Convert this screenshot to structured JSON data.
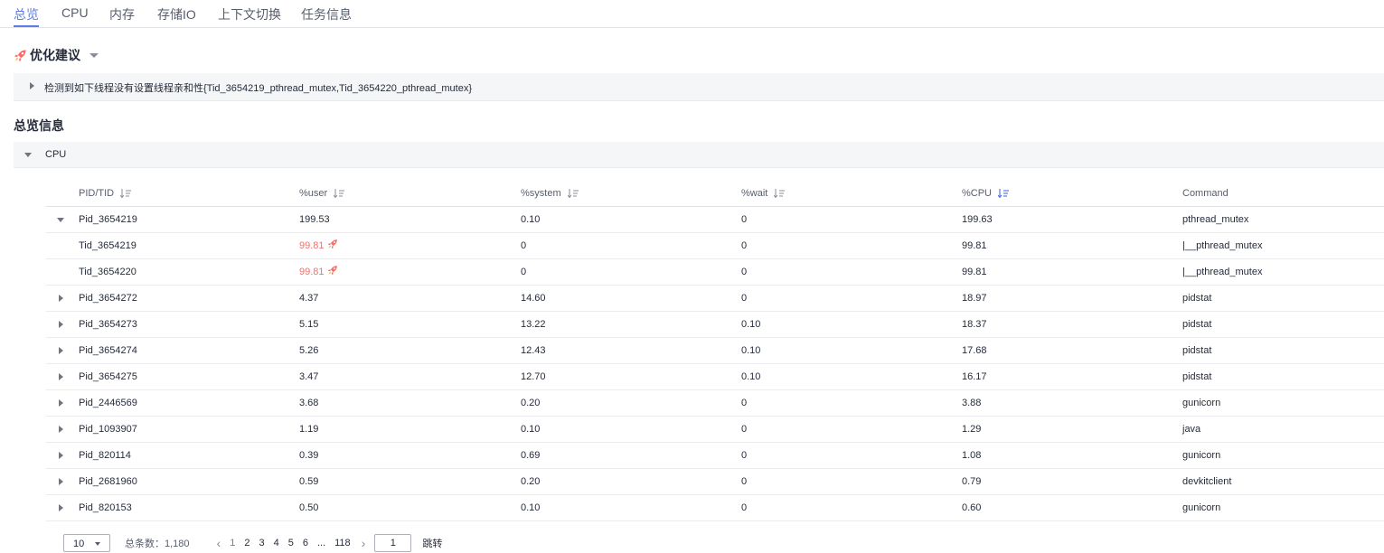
{
  "tabs": [
    {
      "label": "总览",
      "active": true
    },
    {
      "label": "CPU",
      "active": false
    },
    {
      "label": "内存",
      "active": false
    },
    {
      "label": "存储IO",
      "active": false
    },
    {
      "label": "上下文切换",
      "active": false
    },
    {
      "label": "任务信息",
      "active": false
    }
  ],
  "optimization": {
    "title": "优化建议",
    "suggestion": "检测到如下线程没有设置线程亲和性{Tid_3654219_pthread_mutex,Tid_3654220_pthread_mutex}"
  },
  "overview": {
    "title": "总览信息",
    "section_label": "CPU"
  },
  "table": {
    "columns": [
      "PID/TID",
      "%user",
      "%system",
      "%wait",
      "%CPU",
      "Command"
    ],
    "active_sort_column": "%CPU",
    "rows": [
      {
        "pid": "Pid_3654219",
        "user": "199.53",
        "system": "0.10",
        "wait": "0",
        "cpu": "199.63",
        "command": "pthread_mutex",
        "kind": "parent-expanded"
      },
      {
        "pid": "Tid_3654219",
        "user": "99.81",
        "system": "0",
        "wait": "0",
        "cpu": "99.81",
        "command": "|__pthread_mutex",
        "kind": "child",
        "hot": true
      },
      {
        "pid": "Tid_3654220",
        "user": "99.81",
        "system": "0",
        "wait": "0",
        "cpu": "99.81",
        "command": "|__pthread_mutex",
        "kind": "child",
        "hot": true
      },
      {
        "pid": "Pid_3654272",
        "user": "4.37",
        "system": "14.60",
        "wait": "0",
        "cpu": "18.97",
        "command": "pidstat",
        "kind": "parent"
      },
      {
        "pid": "Pid_3654273",
        "user": "5.15",
        "system": "13.22",
        "wait": "0.10",
        "cpu": "18.37",
        "command": "pidstat",
        "kind": "parent"
      },
      {
        "pid": "Pid_3654274",
        "user": "5.26",
        "system": "12.43",
        "wait": "0.10",
        "cpu": "17.68",
        "command": "pidstat",
        "kind": "parent"
      },
      {
        "pid": "Pid_3654275",
        "user": "3.47",
        "system": "12.70",
        "wait": "0.10",
        "cpu": "16.17",
        "command": "pidstat",
        "kind": "parent"
      },
      {
        "pid": "Pid_2446569",
        "user": "3.68",
        "system": "0.20",
        "wait": "0",
        "cpu": "3.88",
        "command": "gunicorn",
        "kind": "parent"
      },
      {
        "pid": "Pid_1093907",
        "user": "1.19",
        "system": "0.10",
        "wait": "0",
        "cpu": "1.29",
        "command": "java",
        "kind": "parent"
      },
      {
        "pid": "Pid_820114",
        "user": "0.39",
        "system": "0.69",
        "wait": "0",
        "cpu": "1.08",
        "command": "gunicorn",
        "kind": "parent"
      },
      {
        "pid": "Pid_2681960",
        "user": "0.59",
        "system": "0.20",
        "wait": "0",
        "cpu": "0.79",
        "command": "devkitclient",
        "kind": "parent"
      },
      {
        "pid": "Pid_820153",
        "user": "0.50",
        "system": "0.10",
        "wait": "0",
        "cpu": "0.60",
        "command": "gunicorn",
        "kind": "parent"
      }
    ]
  },
  "pagination": {
    "page_size": "10",
    "total_label": "总条数：1,180",
    "pages": [
      "1",
      "2",
      "3",
      "4",
      "5",
      "6",
      "...",
      "118"
    ],
    "current_page": "1",
    "jump_value": "1",
    "jump_label": "跳转",
    "prev_icon": "‹",
    "next_icon": "›"
  },
  "colors": {
    "accent": "#5e7ce0",
    "hot": "#f66f6a",
    "text": "#252b3a",
    "muted": "#575d6c",
    "panel": "#f5f6f8"
  }
}
